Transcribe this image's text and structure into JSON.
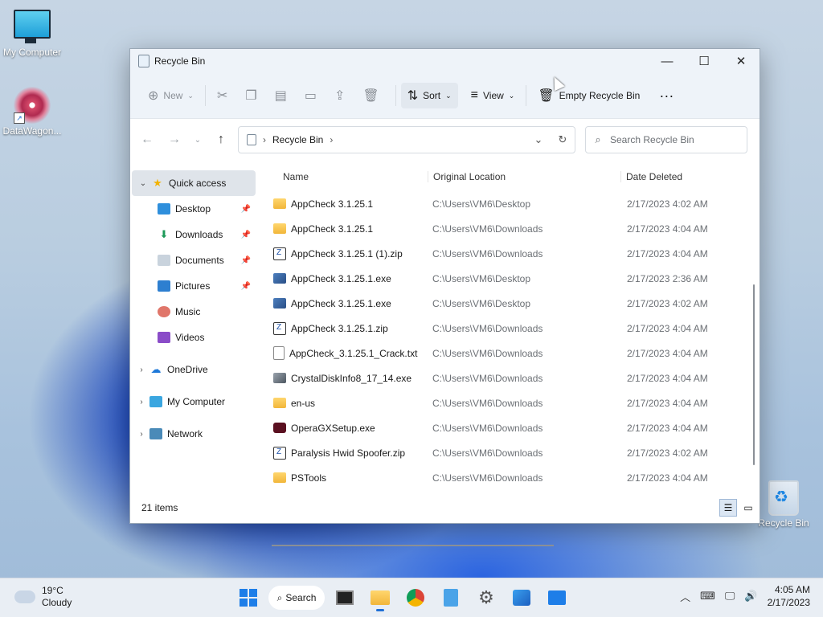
{
  "desktop": {
    "icons": [
      {
        "label": "My Computer"
      },
      {
        "label": "DataWagon..."
      },
      {
        "label": "Recycle Bin"
      }
    ]
  },
  "window": {
    "title": "Recycle Bin",
    "toolbar": {
      "new_label": "New",
      "sort_label": "Sort",
      "view_label": "View",
      "empty_label": "Empty Recycle Bin"
    },
    "address": {
      "crumb": "Recycle Bin"
    },
    "search": {
      "placeholder": "Search Recycle Bin"
    },
    "nav": {
      "quick_access": "Quick access",
      "items": [
        {
          "label": "Desktop"
        },
        {
          "label": "Downloads"
        },
        {
          "label": "Documents"
        },
        {
          "label": "Pictures"
        },
        {
          "label": "Music"
        },
        {
          "label": "Videos"
        }
      ],
      "onedrive": "OneDrive",
      "mycomputer": "My Computer",
      "network": "Network"
    },
    "columns": {
      "name": "Name",
      "location": "Original Location",
      "date": "Date Deleted"
    },
    "rows": [
      {
        "name": "AppCheck 3.1.25.1",
        "type": "folder",
        "location": "C:\\Users\\VM6\\Desktop",
        "date": "2/17/2023 4:02 AM"
      },
      {
        "name": "AppCheck 3.1.25.1",
        "type": "folder",
        "location": "C:\\Users\\VM6\\Downloads",
        "date": "2/17/2023 4:04 AM"
      },
      {
        "name": "AppCheck 3.1.25.1 (1).zip",
        "type": "zip",
        "location": "C:\\Users\\VM6\\Downloads",
        "date": "2/17/2023 4:04 AM"
      },
      {
        "name": "AppCheck 3.1.25.1.exe",
        "type": "exe",
        "location": "C:\\Users\\VM6\\Desktop",
        "date": "2/17/2023 2:36 AM"
      },
      {
        "name": "AppCheck 3.1.25.1.exe",
        "type": "exe",
        "location": "C:\\Users\\VM6\\Desktop",
        "date": "2/17/2023 4:02 AM"
      },
      {
        "name": "AppCheck 3.1.25.1.zip",
        "type": "zip",
        "location": "C:\\Users\\VM6\\Downloads",
        "date": "2/17/2023 4:04 AM"
      },
      {
        "name": "AppCheck_3.1.25.1_Crack.txt",
        "type": "txt",
        "location": "C:\\Users\\VM6\\Downloads",
        "date": "2/17/2023 4:04 AM"
      },
      {
        "name": "CrystalDiskInfo8_17_14.exe",
        "type": "crystal",
        "location": "C:\\Users\\VM6\\Downloads",
        "date": "2/17/2023 4:04 AM"
      },
      {
        "name": "en-us",
        "type": "folder",
        "location": "C:\\Users\\VM6\\Downloads",
        "date": "2/17/2023 4:04 AM"
      },
      {
        "name": "OperaGXSetup.exe",
        "type": "opera",
        "location": "C:\\Users\\VM6\\Downloads",
        "date": "2/17/2023 4:04 AM"
      },
      {
        "name": "Paralysis Hwid Spoofer.zip",
        "type": "zip",
        "location": "C:\\Users\\VM6\\Downloads",
        "date": "2/17/2023 4:02 AM"
      },
      {
        "name": "PSTools",
        "type": "folder",
        "location": "C:\\Users\\VM6\\Downloads",
        "date": "2/17/2023 4:04 AM"
      }
    ],
    "status": {
      "count": "21 items"
    }
  },
  "taskbar": {
    "weather": {
      "temp": "19°C",
      "desc": "Cloudy"
    },
    "search_label": "Search",
    "clock": {
      "time": "4:05 AM",
      "date": "2/17/2023"
    }
  }
}
